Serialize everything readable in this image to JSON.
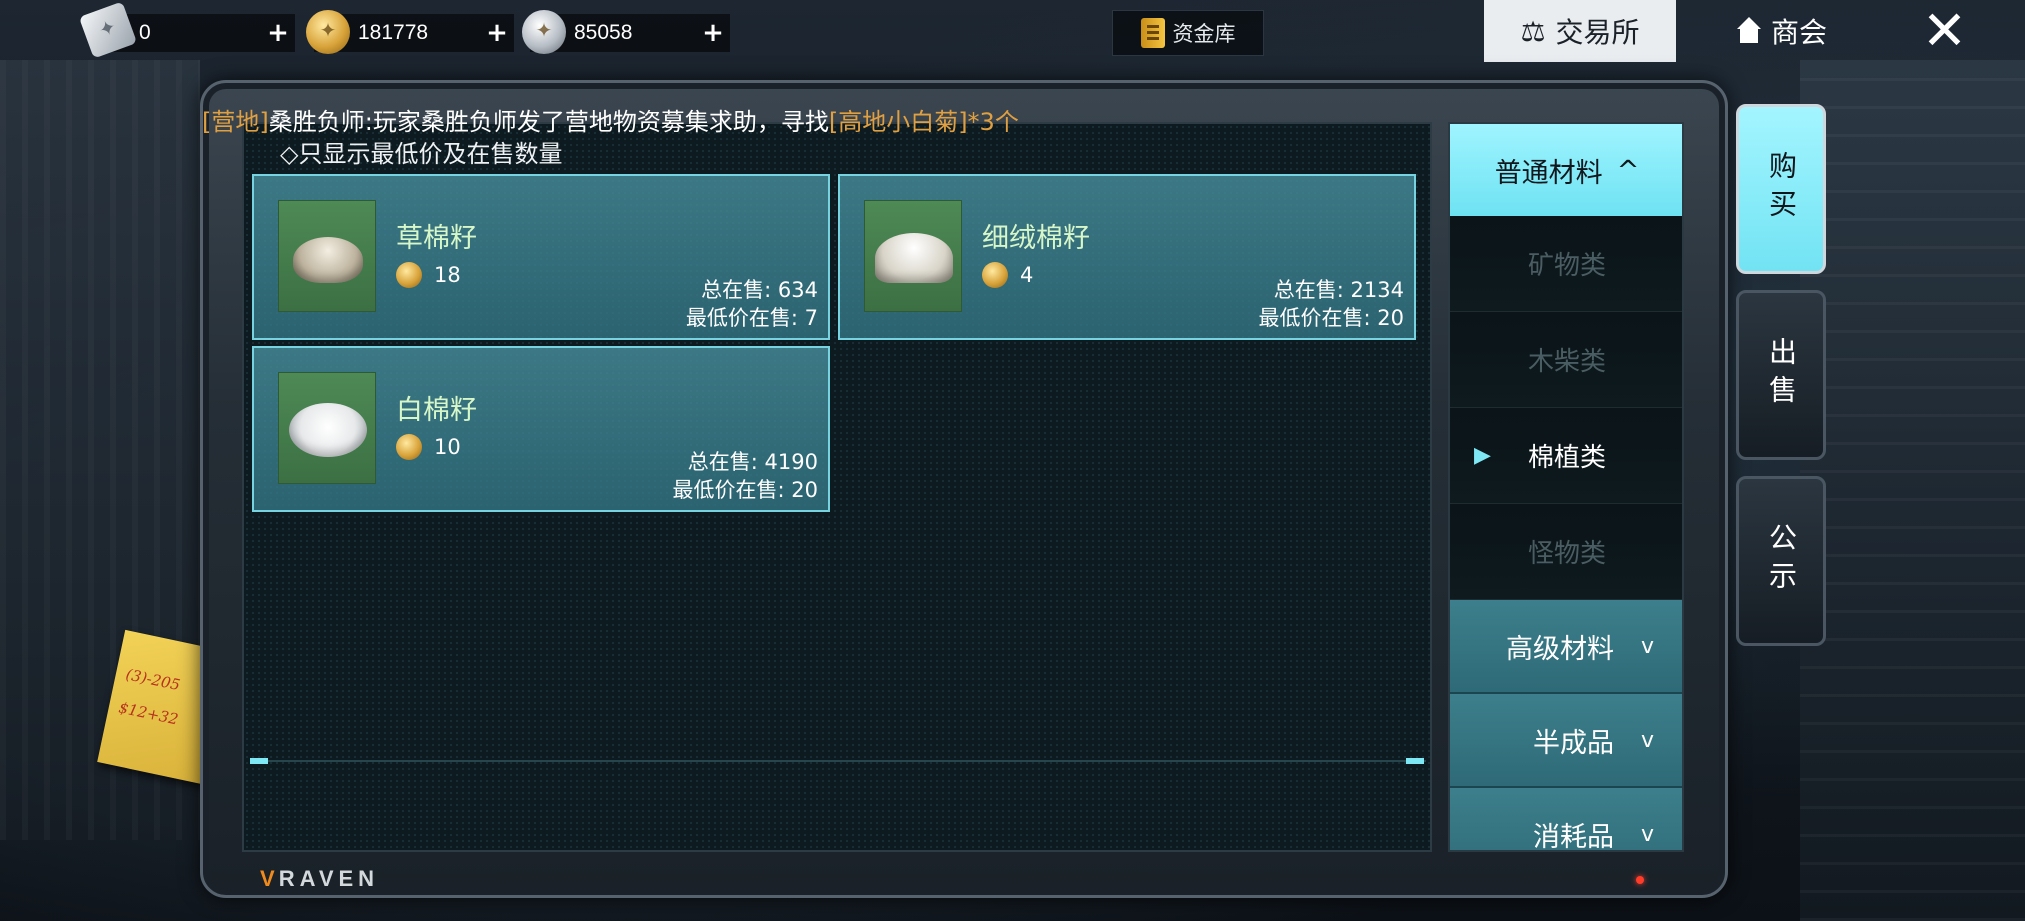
{
  "currency": {
    "ticket": {
      "icon": "ticket-icon",
      "value": "0"
    },
    "gold": {
      "icon": "gold-coin-icon",
      "value": "181778"
    },
    "silver": {
      "icon": "silver-coin-icon",
      "value": "85058"
    },
    "add_label": "+"
  },
  "header": {
    "vault_label": "资金库",
    "tabs": [
      {
        "label": "交易所",
        "icon": "scale-icon",
        "active": true
      },
      {
        "label": "商会",
        "icon": "home-icon",
        "active": false
      }
    ],
    "close_icon": "close-icon"
  },
  "notice": {
    "channel": "[营地]",
    "text": "桑胜负师:玩家桑胜负师发了营地物资募集求助，寻找",
    "tail": "[高地小白菊]*3个"
  },
  "filter_note": "◇只显示最低价及在售数量",
  "items": [
    {
      "name": "草棉籽",
      "price": "18",
      "total_label": "总在售:",
      "total": "634",
      "low_label": "最低价在售:",
      "low": "7"
    },
    {
      "name": "细绒棉籽",
      "price": "4",
      "total_label": "总在售:",
      "total": "2134",
      "low_label": "最低价在售:",
      "low": "20"
    },
    {
      "name": "白棉籽",
      "price": "10",
      "total_label": "总在售:",
      "total": "4190",
      "low_label": "最低价在售:",
      "low": "20"
    }
  ],
  "categories": {
    "open_group": "普通材料",
    "subs": [
      {
        "label": "矿物类",
        "active": false
      },
      {
        "label": "木柴类",
        "active": false
      },
      {
        "label": "棉植类",
        "active": true
      },
      {
        "label": "怪物类",
        "active": false
      }
    ],
    "groups": [
      "高级材料",
      "半成品",
      "消耗品"
    ],
    "expand_glyph": "^",
    "collapse_glyph": "v",
    "active_marker": "▶"
  },
  "side_tabs": [
    {
      "label": "购买",
      "active": true
    },
    {
      "label": "出售",
      "active": false
    },
    {
      "label": "公示",
      "active": false
    }
  ],
  "brand": "RAVEN",
  "sticky_note": [
    "(3)-205",
    "$12+32"
  ],
  "colors": {
    "accent_cyan": "#7ee8f5",
    "card_teal": "#3f8797",
    "notice_orange": "#e0a041",
    "item_name_green": "#d8f7c9"
  }
}
